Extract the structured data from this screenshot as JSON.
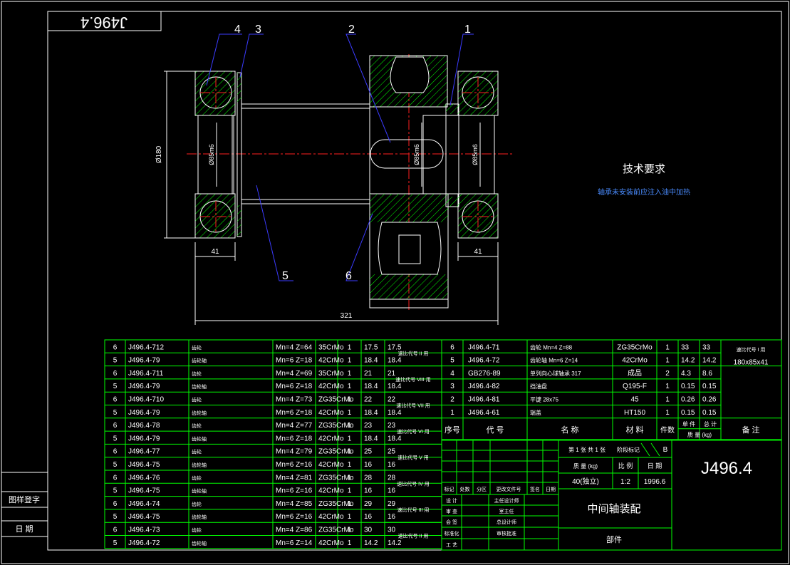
{
  "drawing_number": "J496.4",
  "title_block": {
    "drawing_number": "J496.4",
    "assembly_name": "中间轴装配",
    "subtitle": "部件",
    "sheet": "第 1 张 共 1 张",
    "version_label": "阶段标记",
    "version": "B",
    "weight_label": "质 量 (kg)",
    "weight_value": "40(独立)",
    "scale_label": "比 例",
    "scale_value": "1:2",
    "date_label": "日 期",
    "date_value": "1996.6",
    "rev_headers": [
      "标记",
      "处数",
      "分区",
      "更改文件号",
      "签名",
      "日期"
    ],
    "signatures_left": [
      "设 计",
      "审 查",
      "会 签",
      "标准化",
      "工 艺"
    ],
    "signatures_right": [
      "主任设计师",
      "室主任",
      "总设计师",
      "审核批准"
    ]
  },
  "technical_requirements": {
    "heading": "技术要求",
    "note": "轴承未安装前应注入油中加热"
  },
  "dimensions": {
    "outer_diameter": "Ø180",
    "left_bearing_width": "41",
    "right_bearing_width": "41",
    "total_length": "321",
    "shaft_left_diameter": "Ø85m6",
    "shaft_center_diameter": "Ø85m6",
    "shaft_right_diameter": "Ø85m6"
  },
  "balloons": [
    "4",
    "3",
    "2",
    "1",
    "5",
    "6"
  ],
  "variant_table": {
    "rows": [
      {
        "no": "6",
        "code": "J496.4-712",
        "name": "齿轮",
        "param": "Mn=4 Z=64",
        "material": "35CrMo",
        "qty": "1",
        "unit": "17.5",
        "total": "17.5"
      },
      {
        "no": "5",
        "code": "J496.4-79",
        "name": "齿轮轴",
        "param": "Mn=6 Z=18",
        "material": "42CrMo",
        "qty": "1",
        "unit": "18.4",
        "total": "18.4"
      },
      {
        "no": "6",
        "code": "J496.4-711",
        "name": "齿轮",
        "param": "Mn=4 Z=69",
        "material": "35CrMo",
        "qty": "1",
        "unit": "21",
        "total": "21"
      },
      {
        "no": "5",
        "code": "J496.4-79",
        "name": "齿轮轴",
        "param": "Mn=6 Z=18",
        "material": "42CrMo",
        "qty": "1",
        "unit": "18.4",
        "total": "18.4"
      },
      {
        "no": "6",
        "code": "J496.4-710",
        "name": "齿轮",
        "param": "Mn=4 Z=73",
        "material": "ZG35CrMo",
        "qty": "1",
        "unit": "22",
        "total": "22"
      },
      {
        "no": "5",
        "code": "J496.4-79",
        "name": "齿轮轴",
        "param": "Mn=6 Z=18",
        "material": "42CrMo",
        "qty": "1",
        "unit": "18.4",
        "total": "18.4"
      },
      {
        "no": "6",
        "code": "J496.4-78",
        "name": "齿轮",
        "param": "Mn=4 Z=77",
        "material": "ZG35CrMo",
        "qty": "1",
        "unit": "23",
        "total": "23"
      },
      {
        "no": "5",
        "code": "J496.4-79",
        "name": "齿轮轴",
        "param": "Mn=6 Z=18",
        "material": "42CrMo",
        "qty": "1",
        "unit": "18.4",
        "total": "18.4"
      },
      {
        "no": "6",
        "code": "J496.4-77",
        "name": "齿轮",
        "param": "Mn=4 Z=79",
        "material": "ZG35CrMo",
        "qty": "1",
        "unit": "25",
        "total": "25"
      },
      {
        "no": "5",
        "code": "J496.4-75",
        "name": "齿轮轴",
        "param": "Mn=6 Z=16",
        "material": "42CrMo",
        "qty": "1",
        "unit": "16",
        "total": "16"
      },
      {
        "no": "6",
        "code": "J496.4-76",
        "name": "齿轮",
        "param": "Mn=4 Z=81",
        "material": "ZG35CrMo",
        "qty": "1",
        "unit": "28",
        "total": "28"
      },
      {
        "no": "5",
        "code": "J496.4-75",
        "name": "齿轮轴",
        "param": "Mn=6 Z=16",
        "material": "42CrMo",
        "qty": "1",
        "unit": "16",
        "total": "16"
      },
      {
        "no": "6",
        "code": "J496.4-74",
        "name": "齿轮",
        "param": "Mn=4 Z=85",
        "material": "ZG35CrMo",
        "qty": "1",
        "unit": "29",
        "total": "29"
      },
      {
        "no": "5",
        "code": "J496.4-75",
        "name": "齿轮轴",
        "param": "Mn=6 Z=16",
        "material": "42CrMo",
        "qty": "1",
        "unit": "16",
        "total": "16"
      },
      {
        "no": "6",
        "code": "J496.4-73",
        "name": "齿轮",
        "param": "Mn=4 Z=86",
        "material": "ZG35CrMo",
        "qty": "1",
        "unit": "30",
        "total": "30"
      },
      {
        "no": "5",
        "code": "J496.4-72",
        "name": "齿轮轴",
        "param": "Mn=6 Z=14",
        "material": "42CrMo",
        "qty": "1",
        "unit": "14.2",
        "total": "14.2"
      }
    ],
    "group_labels": [
      "速比代号 II 用",
      "速比代号 VIII 用",
      "速比代号 VII 用",
      "速比代号 VI 用",
      "速比代号 V 用",
      "速比代号 IV 用",
      "速比代号 III 用",
      "速比代号 II 用"
    ]
  },
  "parts_list": {
    "rows": [
      {
        "no": "6",
        "code": "J496.4-71",
        "name": "齿轮",
        "param": "Mn=4 Z=88",
        "material": "ZG35CrMo",
        "qty": "1",
        "unit": "33",
        "total": "33"
      },
      {
        "no": "5",
        "code": "J496.4-72",
        "name": "齿轮轴",
        "param": "Mn=6 Z=14",
        "material": "42CrMo",
        "qty": "1",
        "unit": "14.2",
        "total": "14.2"
      },
      {
        "no": "4",
        "code": "GB276-89",
        "name": "单列向心球轴承",
        "param": "317",
        "material": "成品",
        "qty": "2",
        "unit": "4.3",
        "total": "8.6"
      },
      {
        "no": "3",
        "code": "J496.4-82",
        "name": "挡油盘",
        "param": "",
        "material": "Q195-F",
        "qty": "1",
        "unit": "0.15",
        "total": "0.15"
      },
      {
        "no": "2",
        "code": "J496.4-81",
        "name": "平键",
        "param": "28x75",
        "material": "45",
        "qty": "1",
        "unit": "0.26",
        "total": "0.26"
      },
      {
        "no": "1",
        "code": "J496.4-61",
        "name": "端盖",
        "param": "",
        "material": "HT150",
        "qty": "1",
        "unit": "0.15",
        "total": "0.15"
      }
    ],
    "remark_label": "速比代号 I 用",
    "remark_size": "180x85x41",
    "headers": {
      "no": "序号",
      "code": "代 号",
      "name": "名 称",
      "material": "材 料",
      "qty": "件数",
      "unit": "单 件",
      "total": "总 计",
      "weight": "质 量 (kg)",
      "remark": "备 注"
    }
  },
  "side_labels": [
    "图样登字",
    "日 期"
  ]
}
